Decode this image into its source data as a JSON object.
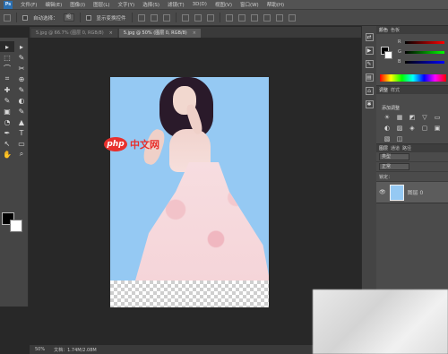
{
  "app": {
    "logo": "Ps"
  },
  "menubar": [
    "文件(F)",
    "编辑(E)",
    "图像(I)",
    "图层(L)",
    "文字(Y)",
    "选择(S)",
    "滤镜(T)",
    "3D(D)",
    "视图(V)",
    "窗口(W)",
    "帮助(H)"
  ],
  "options": {
    "auto_select_label": "自动选择：",
    "auto_select_value": "组",
    "show_transform_label": "显示变换控件"
  },
  "tabs": [
    {
      "label": "5.jpg @ 66.7% (图层 0, RGB/8)",
      "close": "×"
    },
    {
      "label": "5.jpg @ 50% (图层 0, RGB/8)",
      "close": "×"
    }
  ],
  "tools": [
    "▸",
    "▸",
    "⬚",
    "✎",
    "⌒",
    "✂",
    "⌗",
    "⊕",
    "✚",
    "✎",
    "✎",
    "◐",
    "▣",
    "✎",
    "◔",
    "▲",
    "✒",
    "T",
    "↖",
    "▭",
    "✋",
    "⌕"
  ],
  "watermark": {
    "oval": "php",
    "text": "中文网"
  },
  "status": {
    "zoom": "50%",
    "doc": "文档：1.74M/2.08M"
  },
  "dock_icons": [
    "⇄",
    "▶",
    "✎",
    "▤",
    "⌂",
    "✱"
  ],
  "panels": {
    "color_tabs": [
      "颜色",
      "色板"
    ],
    "channels": [
      "R",
      "G",
      "B"
    ],
    "adj_tabs": [
      "调整",
      "样式"
    ],
    "adj_title": "添加调整",
    "adj_icons": [
      "☀",
      "▦",
      "◩",
      "▽",
      "▭",
      "◐",
      "▨",
      "◈",
      "▢",
      "▣",
      "▧",
      "◫"
    ],
    "layer_tabs": [
      "图层",
      "通道",
      "路径"
    ],
    "kind_label": "类型",
    "blend_mode": "正常",
    "lock_label": "锁定：",
    "layer_name": "图层 0",
    "eye": "👁"
  },
  "colors": {
    "accent": "#e8302d",
    "doc_bg": "#95c9f3"
  }
}
